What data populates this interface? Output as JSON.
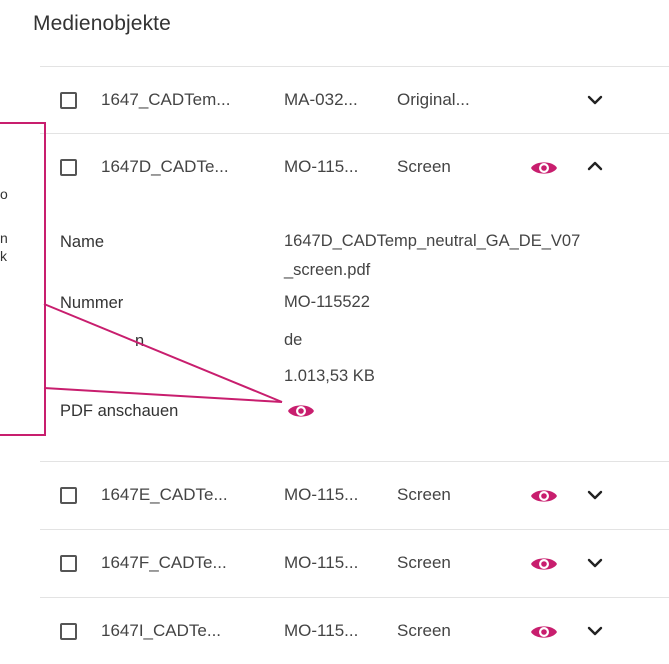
{
  "page": {
    "title": "Medienobjekte"
  },
  "rows": [
    {
      "file": "1647_CADTem...",
      "number": "MA-032...",
      "type": "Original..."
    },
    {
      "file": "1647D_CADTe...",
      "number": "MO-115...",
      "type": "Screen"
    },
    {
      "file": "1647E_CADTe...",
      "number": "MO-115...",
      "type": "Screen"
    },
    {
      "file": "1647F_CADTe...",
      "number": "MO-115...",
      "type": "Screen"
    },
    {
      "file": "1647I_CADTe...",
      "number": "MO-115...",
      "type": "Screen"
    }
  ],
  "detail": {
    "name_label": "Name",
    "name_value_1": "1647D_CADTemp_neutral_GA_DE_V07",
    "name_value_2": "_screen.pdf",
    "number_label": "Nummer",
    "number_value": "MO-115522",
    "language_label_partial": "n",
    "language_value": "de",
    "size_value": "1.013,53 KB",
    "pdf_label": "PDF anschauen"
  },
  "callout": {
    "fragments": [
      "o",
      "n",
      "k"
    ]
  },
  "icons": {
    "view": "eye-icon",
    "expand": "chevron-down-icon",
    "collapse": "chevron-up-icon"
  },
  "colors": {
    "accent": "#c81e6e",
    "text": "#333333",
    "divider": "#e3e3e3"
  }
}
